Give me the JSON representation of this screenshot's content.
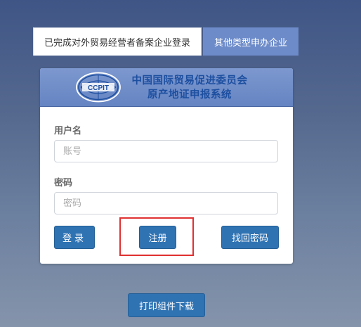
{
  "tabs": {
    "active_label": "已完成对外贸易经营者备案企业登录",
    "inactive_label": "其他类型申办企业"
  },
  "header": {
    "logo_text": "CCPIT",
    "title_line1": "中国国际贸易促进委员会",
    "title_line2": "原产地证申报系统"
  },
  "form": {
    "username_label": "用户名",
    "username_placeholder": "账号",
    "password_label": "密码",
    "password_placeholder": "密码"
  },
  "buttons": {
    "login": "登录",
    "register": "注册",
    "find_password": "找回密码",
    "print_download": "打印组件下载"
  },
  "colors": {
    "button_blue": "#2f73b3",
    "tab_inactive": "#6d8bc9",
    "highlight_red": "#e03131",
    "title_blue": "#1d4fa0"
  }
}
